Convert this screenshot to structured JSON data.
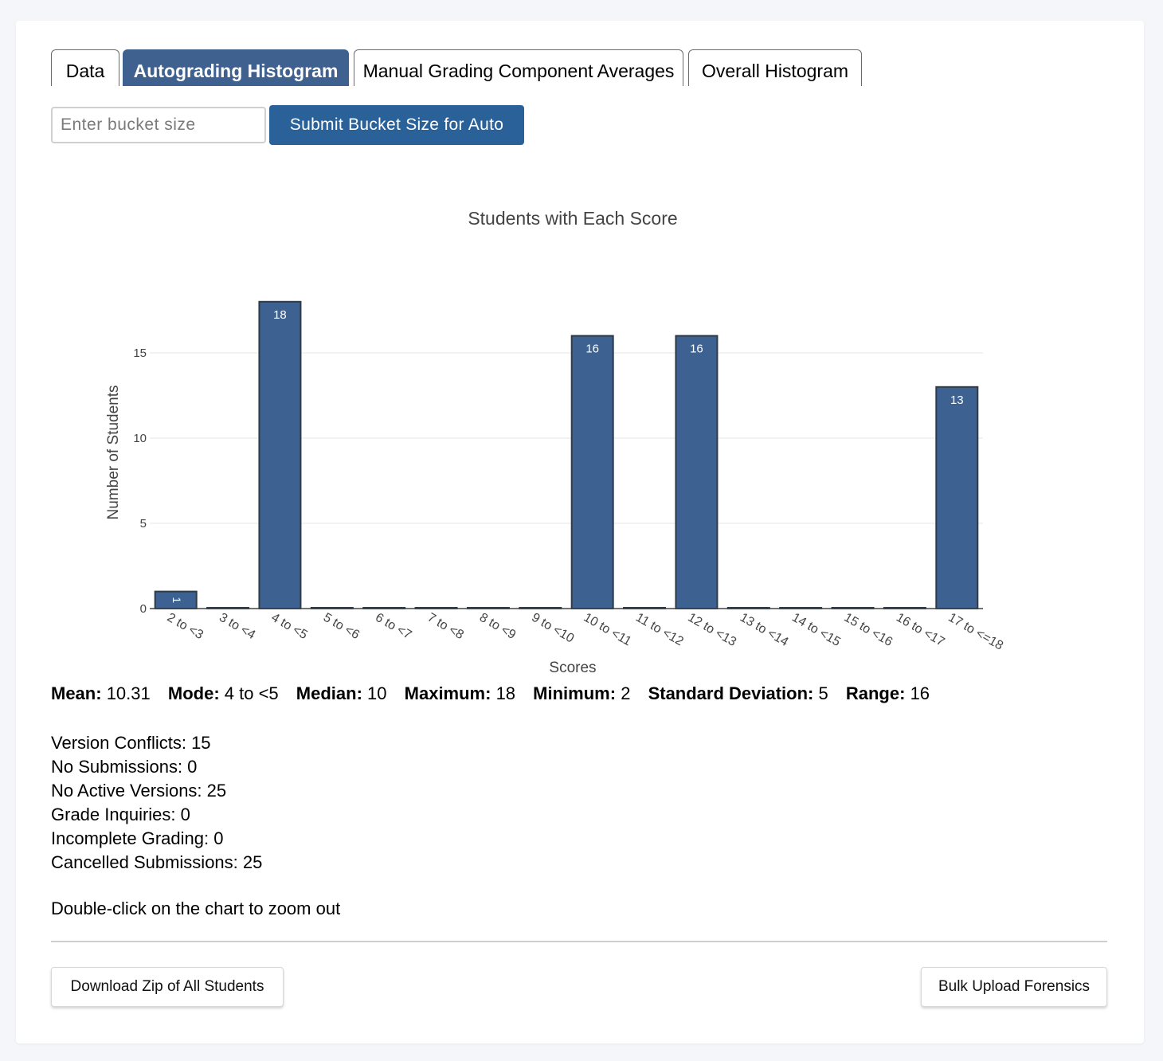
{
  "tabs": [
    {
      "label": "Data",
      "active": false
    },
    {
      "label": "Autograding Histogram",
      "active": true
    },
    {
      "label": "Manual Grading Component Averages",
      "active": false
    },
    {
      "label": "Overall Histogram",
      "active": false
    }
  ],
  "bucket": {
    "placeholder": "Enter bucket size",
    "submit_label": "Submit Bucket Size for Auto"
  },
  "colors": {
    "bar": "#3d6291",
    "active_tab": "#3f6190",
    "submit_button": "#2b6199"
  },
  "chart_data": {
    "type": "bar",
    "title": "Students with Each Score",
    "xlabel": "Scores",
    "ylabel": "Number of Students",
    "categories": [
      "2 to <3",
      "3 to <4",
      "4 to <5",
      "5 to <6",
      "6 to <7",
      "7 to <8",
      "8 to <9",
      "9 to <10",
      "10 to <11",
      "11 to <12",
      "12 to <13",
      "13 to <14",
      "14 to <15",
      "15 to <16",
      "16 to <17",
      "17 to <=18"
    ],
    "values": [
      1,
      0,
      18,
      0,
      0,
      0,
      0,
      0,
      16,
      0,
      16,
      0,
      0,
      0,
      0,
      13
    ],
    "ylim": [
      0,
      20
    ],
    "yticks": [
      0,
      5,
      10,
      15
    ],
    "grid": true,
    "data_labels": true
  },
  "stats": [
    {
      "label": "Mean:",
      "value": "10.31"
    },
    {
      "label": "Mode:",
      "value": "4 to <5"
    },
    {
      "label": "Median:",
      "value": "10"
    },
    {
      "label": "Maximum:",
      "value": "18"
    },
    {
      "label": "Minimum:",
      "value": "2"
    },
    {
      "label": "Standard Deviation:",
      "value": "5"
    },
    {
      "label": "Range:",
      "value": "16"
    }
  ],
  "counts": [
    "Version Conflicts: 15",
    "No Submissions: 0",
    "No Active Versions: 25",
    "Grade Inquiries: 0",
    "Incomplete Grading: 0",
    "Cancelled Submissions: 25"
  ],
  "zoom_hint": "Double-click on the chart to zoom out",
  "buttons": {
    "download_zip": "Download Zip of All Students",
    "bulk_upload": "Bulk Upload Forensics"
  }
}
